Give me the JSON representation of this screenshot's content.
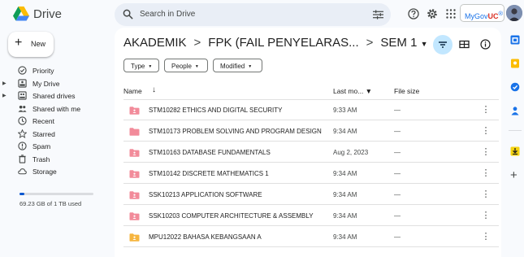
{
  "app": {
    "title": "Drive"
  },
  "search": {
    "placeholder": "Search in Drive"
  },
  "account": {
    "name_prefix": "MyGov",
    "name_suffix": "UC",
    "name_mark": "®"
  },
  "new_button": {
    "plus": "+",
    "label": "New"
  },
  "sidebar": {
    "items": [
      {
        "label": "Priority",
        "icon": "check-circle-icon",
        "expandable": false
      },
      {
        "label": "My Drive",
        "icon": "drive-icon",
        "expandable": true
      },
      {
        "label": "Shared drives",
        "icon": "shared-drive-icon",
        "expandable": true
      },
      {
        "label": "Shared with me",
        "icon": "people-icon",
        "expandable": false
      },
      {
        "label": "Recent",
        "icon": "clock-icon",
        "expandable": false
      },
      {
        "label": "Starred",
        "icon": "star-icon",
        "expandable": false
      },
      {
        "label": "Spam",
        "icon": "spam-icon",
        "expandable": false
      },
      {
        "label": "Trash",
        "icon": "trash-icon",
        "expandable": false
      },
      {
        "label": "Storage",
        "icon": "cloud-icon",
        "expandable": false
      }
    ],
    "storage": {
      "text": "69.23 GB of 1 TB used",
      "used_fraction": 0.07
    }
  },
  "breadcrumb": {
    "items": [
      "AKADEMIK",
      "FPK (FAIL PENYELARAS...",
      "SEM 1"
    ],
    "separator": ">",
    "caret": "▼"
  },
  "filters": [
    {
      "label": "Type",
      "arrow": "▼"
    },
    {
      "label": "People",
      "arrow": "▼"
    },
    {
      "label": "Modified",
      "arrow": "▼"
    }
  ],
  "table": {
    "headers": {
      "name": "Name",
      "sort_arrow": "↓",
      "modified": "Last mo... ▼",
      "size": "File size"
    },
    "rows": [
      {
        "name": "STM10282 ETHICS AND DIGITAL SECURITY",
        "modified": "9:33 AM",
        "size": "—",
        "shared": true,
        "color": "#f28b9a"
      },
      {
        "name": "STM10173 PROBLEM SOLVING AND PROGRAM DESIGN",
        "modified": "9:34 AM",
        "size": "—",
        "shared": false,
        "color": "#f28b9a"
      },
      {
        "name": "STM10163 DATABASE FUNDAMENTALS",
        "modified": "Aug 2, 2023",
        "size": "—",
        "shared": true,
        "color": "#f28b9a"
      },
      {
        "name": "STM10142 DISCRETE MATHEMATICS 1",
        "modified": "9:34 AM",
        "size": "—",
        "shared": true,
        "color": "#f28b9a"
      },
      {
        "name": "SSK10213 APPLICATION SOFTWARE",
        "modified": "9:34 AM",
        "size": "—",
        "shared": true,
        "color": "#f28b9a"
      },
      {
        "name": "SSK10203 COMPUTER ARCHITECTURE & ASSEMBLY",
        "modified": "9:34 AM",
        "size": "—",
        "shared": true,
        "color": "#f28b9a"
      },
      {
        "name": "MPU12022 BAHASA KEBANGSAAN A",
        "modified": "9:34 AM",
        "size": "—",
        "shared": true,
        "color": "#f6b53f"
      }
    ],
    "more_glyph": "⋮"
  },
  "right_rail": {
    "icons": [
      "calendar-icon",
      "keep-icon",
      "tasks-icon",
      "contacts-icon",
      "download-icon",
      "add-icon"
    ]
  },
  "colors": {
    "accent": "#0b57d0",
    "filter_active": "#c2e7ff",
    "background": "#f8fafd"
  }
}
